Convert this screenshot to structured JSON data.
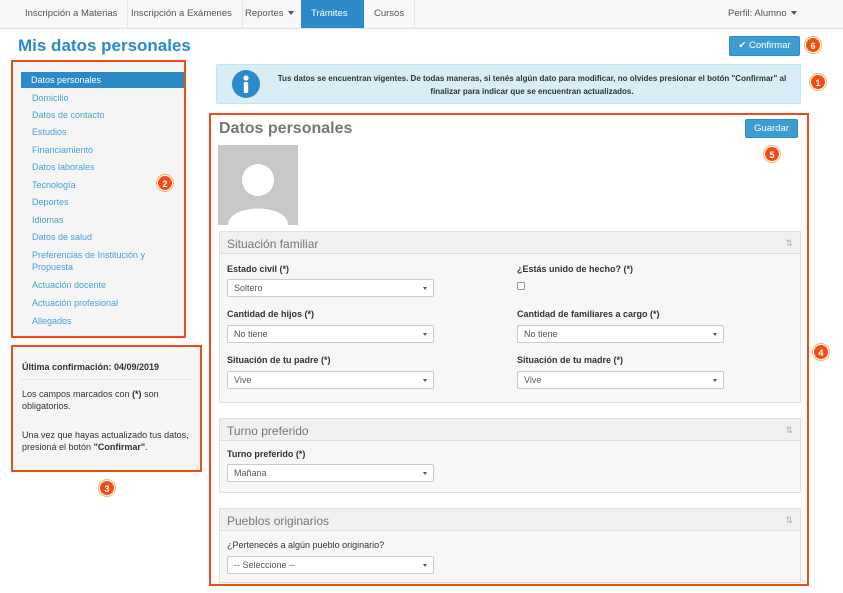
{
  "nav": {
    "items": [
      "Inscripción a Materias",
      "Inscripción a Exámenes",
      "Reportes",
      "Trámites",
      "Cursos"
    ],
    "profile": "Perfil: Alumno"
  },
  "page": {
    "title": "Mis datos personales",
    "confirm_label": "Confirmar"
  },
  "alert": {
    "text": "Tus datos se encuentran vigentes. De todas maneras, si tenés algún dato para modificar, no olvides presionar el botón \"Confirmar\" al finalizar para indicar que se encuentran actualizados."
  },
  "sidebar": {
    "items": [
      "Datos personales",
      "Domicilio",
      "Datos de contacto",
      "Estudios",
      "Financiamiento",
      "Datos laborales",
      "Tecnología",
      "Deportes",
      "Idiomas",
      "Datos de salud",
      "Preferencias de Institución y Propuesta",
      "Actuación docente",
      "Actuación profesional",
      "Allegados"
    ]
  },
  "info": {
    "last_confirmation": "Última confirmación: 04/09/2019",
    "required_prefix": "Los campos marcados con ",
    "required_mark": "(*)",
    "required_suffix": " son obligatorios.",
    "update_prefix": "Una vez que hayas actualizado tus datos, presioná el botón ",
    "update_button": "\"Confirmar\"",
    "update_suffix": "."
  },
  "main": {
    "title": "Datos personales",
    "save_label": "Guardar",
    "family": {
      "title": "Situación familiar",
      "estado_civil_label": "Estado civil (*)",
      "estado_civil_value": "Soltero",
      "union_label": "¿Estás unido de hecho? (*)",
      "hijos_label": "Cantidad de hijos (*)",
      "hijos_value": "No tiene",
      "familiares_label": "Cantidad de familiares a cargo (*)",
      "familiares_value": "No tiene",
      "padre_label": "Situación de tu padre (*)",
      "padre_value": "Vive",
      "madre_label": "Situación de tu madre (*)",
      "madre_value": "Vive"
    },
    "shift": {
      "title": "Turno preferido",
      "label": "Turno preferido (*)",
      "value": "Mañana"
    },
    "peoples": {
      "title": "Pueblos originarios",
      "label": "¿Pertenecés a algún pueblo originario?",
      "value": "-- Seleccione --"
    }
  },
  "badges": [
    "1",
    "2",
    "3",
    "4",
    "5",
    "6"
  ],
  "colors": {
    "accent": "#2c8ac9",
    "annotation": "#ef4a1b",
    "alert_bg": "#d9edf7"
  }
}
